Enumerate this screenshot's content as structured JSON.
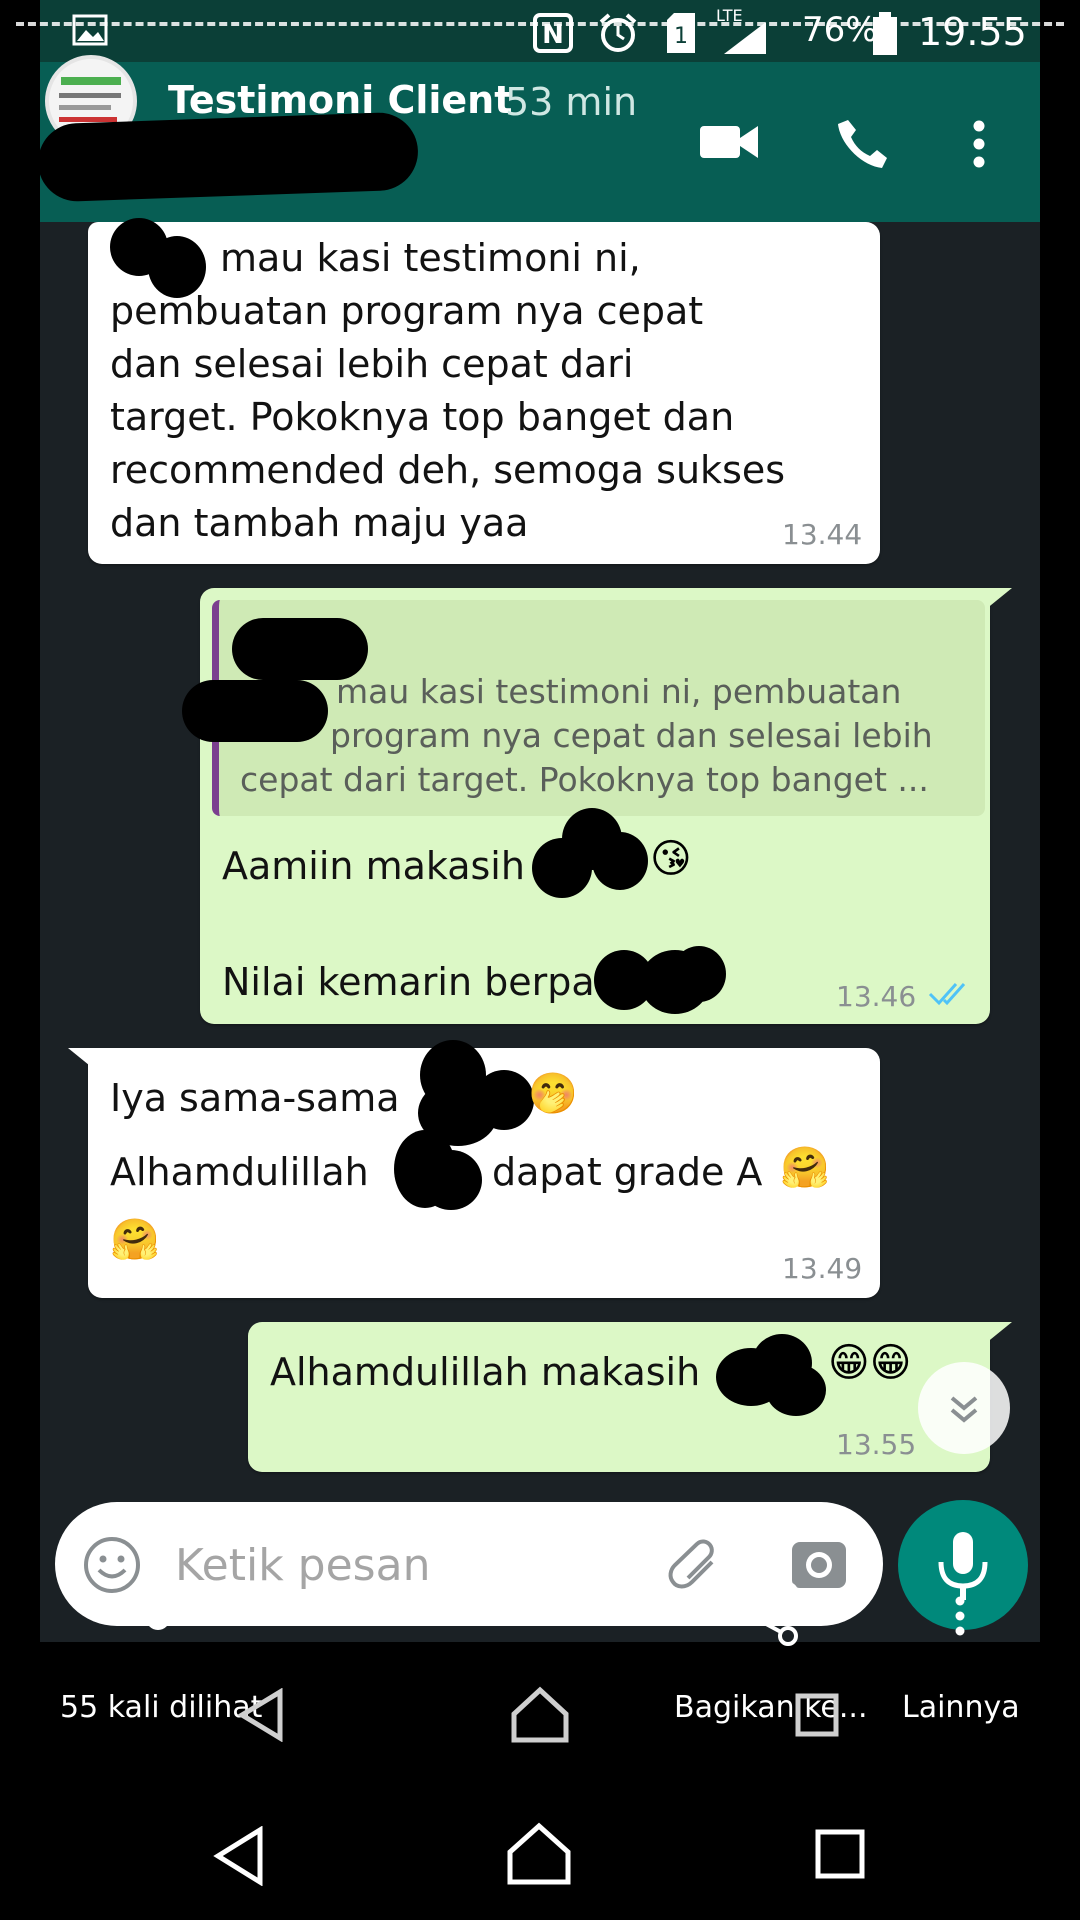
{
  "status_bar": {
    "network": "LTE",
    "battery": "76%",
    "time": "19.55"
  },
  "chat": {
    "title": "Testimoni Client",
    "subtitle": "53 min",
    "input_placeholder": "Ketik pesan"
  },
  "messages": [
    {
      "direction": "in",
      "lines": [
        "mau kasi testimoni ni,",
        "pembuatan program nya cepat",
        "dan selesai lebih cepat dari",
        "target. Pokoknya top banget dan",
        "recommended deh, semoga sukses",
        "dan tambah maju yaa"
      ],
      "time": "13.44"
    },
    {
      "direction": "out",
      "quote_lines": [
        "mau kasi testimoni ni, pembuatan",
        "program nya cepat dan selesai lebih",
        "cepat dari target. Pokoknya top banget ..."
      ],
      "line1": "Aamiin makasih",
      "line1_emoji": "😘",
      "line2": "Nilai kemarin berpa",
      "time": "13.46"
    },
    {
      "direction": "in",
      "line1": "Iya sama-sama",
      "line1_emoji": "🤭",
      "line2_a": "Alhamdulillah",
      "line2_b": "dapat grade A",
      "line2_emoji": "🤗",
      "line3_emoji": "🤗",
      "time": "13.49"
    },
    {
      "direction": "out",
      "text": "Alhamdulillah makasih",
      "emoji": "😁😁",
      "time": "13.55"
    }
  ],
  "viewer_overlay": {
    "views": "55 kali dilihat",
    "share": "Bagikan ke...",
    "more": "Lainnya"
  },
  "colors": {
    "header": "#075e54",
    "outgoing_bubble": "#dcf8c6",
    "incoming_bubble": "#ffffff",
    "mic_button": "#00897b",
    "read_ticks": "#4fc3f7"
  }
}
